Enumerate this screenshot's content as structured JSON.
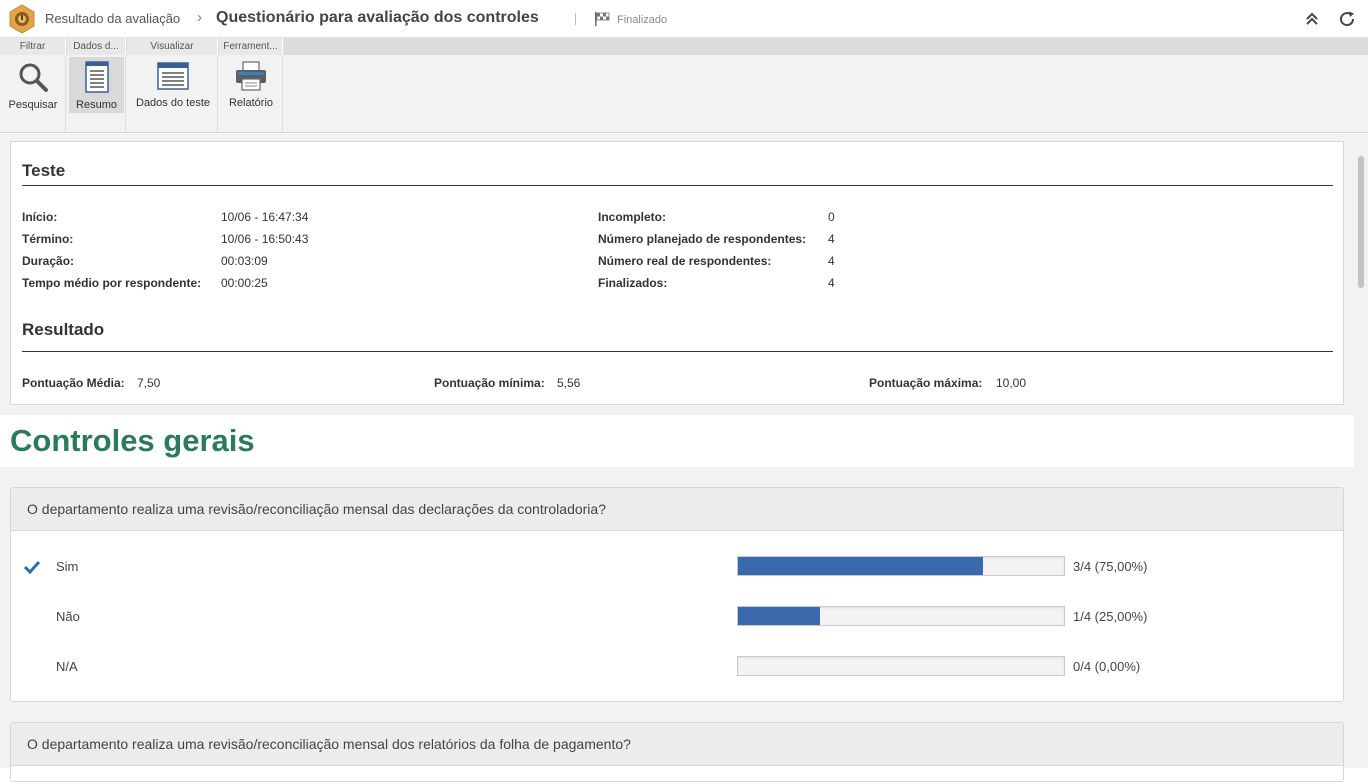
{
  "header": {
    "breadcrumb": "Resultado da avaliação",
    "title": "Questionário para avaliação dos controles",
    "status": "Finalizado"
  },
  "ribbon": {
    "tabs": [
      "Filtrar",
      "Dados d...",
      "Visualizar",
      "Ferrament..."
    ],
    "buttons": {
      "search": "Pesquisar",
      "summary": "Resumo",
      "test_data": "Dados do teste",
      "report": "Relatório"
    }
  },
  "teste": {
    "title": "Teste",
    "left": [
      {
        "label": "Início:",
        "value": "10/06 - 16:47:34"
      },
      {
        "label": "Término:",
        "value": "10/06 - 16:50:43"
      },
      {
        "label": "Duração:",
        "value": "00:03:09"
      },
      {
        "label": "Tempo médio por respondente:",
        "value": "00:00:25"
      }
    ],
    "right": [
      {
        "label": "Incompleto:",
        "value": "0"
      },
      {
        "label": "Número planejado de respondentes:",
        "value": "4"
      },
      {
        "label": "Número real de respondentes:",
        "value": "4"
      },
      {
        "label": "Finalizados:",
        "value": "4"
      }
    ]
  },
  "resultado": {
    "title": "Resultado",
    "avg_label": "Pontuação Média:",
    "avg_value": "7,50",
    "min_label": "Pontuação mínima:",
    "min_value": "5,56",
    "max_label": "Pontuação máxima:",
    "max_value": "10,00"
  },
  "group": {
    "title": "Controles gerais"
  },
  "questions": [
    {
      "text": "O departamento realiza uma revisão/reconciliação mensal das declarações da controladoria?",
      "options": [
        {
          "label": "Sim",
          "fraction": 0.75,
          "result": "3/4 (75,00%)",
          "checked": true
        },
        {
          "label": "Não",
          "fraction": 0.25,
          "result": "1/4 (25,00%)",
          "checked": false
        },
        {
          "label": "N/A",
          "fraction": 0.0,
          "result": "0/4 (0,00%)",
          "checked": false
        }
      ]
    },
    {
      "text": "O departamento realiza uma revisão/reconciliação mensal dos relatórios da folha de pagamento?"
    }
  ],
  "colors": {
    "accent_green": "#2b7a5a",
    "bar_blue": "#3a6aae",
    "check_blue": "#2e6da4"
  }
}
